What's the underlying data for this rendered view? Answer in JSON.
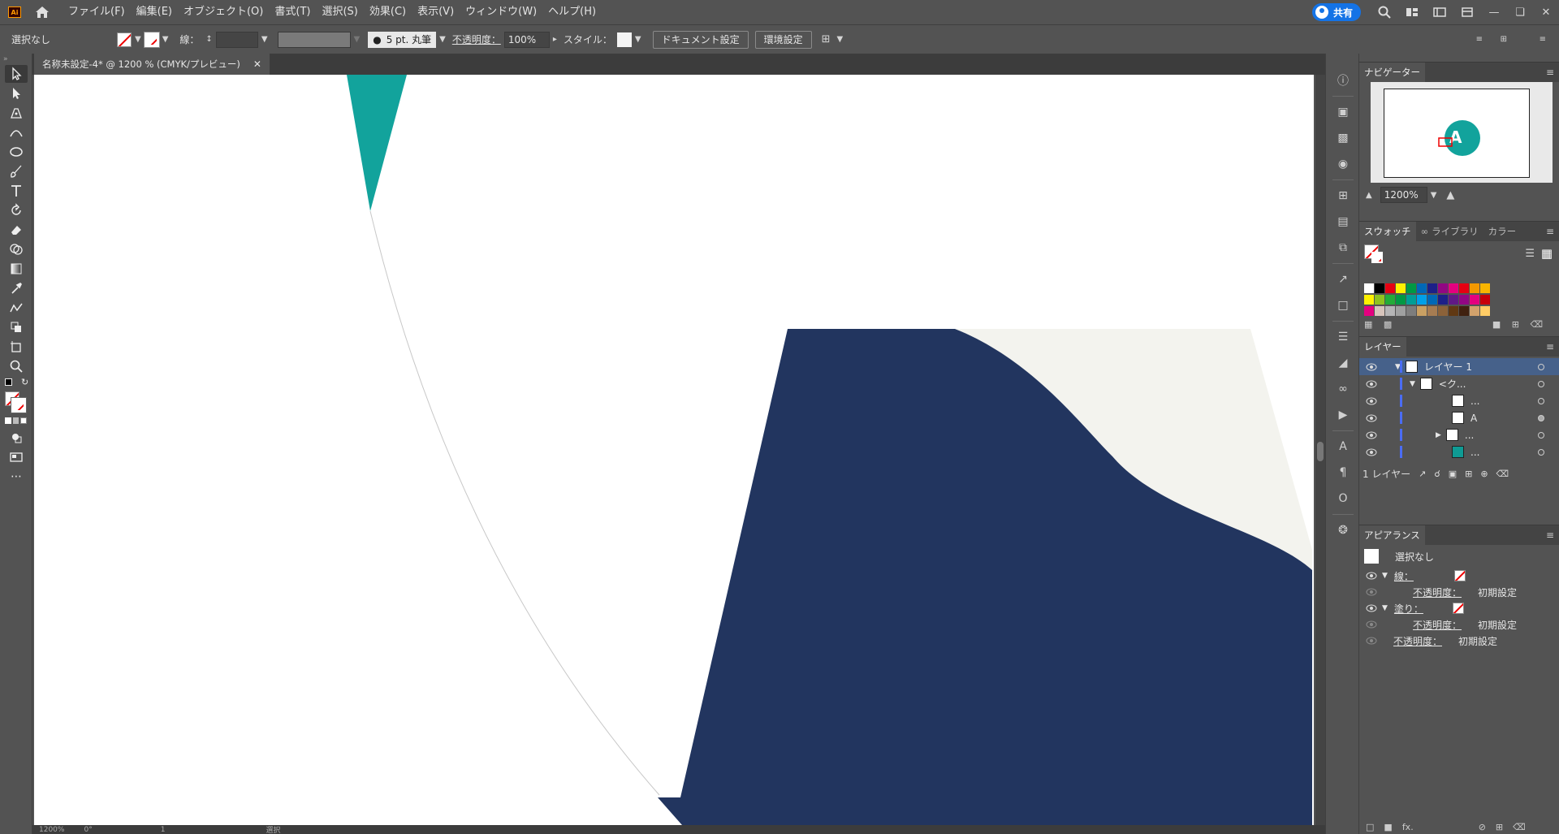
{
  "app": {
    "logo_text": "Ai"
  },
  "menu": [
    "ファイル(F)",
    "編集(E)",
    "オブジェクト(O)",
    "書式(T)",
    "選択(S)",
    "効果(C)",
    "表示(V)",
    "ウィンドウ(W)",
    "ヘルプ(H)"
  ],
  "topright": {
    "share_label": "共有"
  },
  "control": {
    "selection": "選択なし",
    "stroke_label": "線：",
    "brush": "5 pt. 丸筆",
    "opacity_label": "不透明度：",
    "opacity_value": "100%",
    "style_label": "スタイル：",
    "doc_setup": "ドキュメント設定",
    "prefs": "環境設定"
  },
  "document": {
    "tab_title": "名称未設定-4* @ 1200 % (CMYK/プレビュー)"
  },
  "statusbar": {
    "zoom": "1200%",
    "angle": "0°",
    "artboard": "1",
    "tool": "選択"
  },
  "navigator": {
    "tab": "ナビゲーター",
    "zoom": "1200%"
  },
  "swatches": {
    "tabs": [
      "スウォッチ",
      "ライブラリ",
      "カラー"
    ],
    "row1": [
      "#ffffff",
      "#000000",
      "#e60012",
      "#fff100",
      "#009944",
      "#0068b7",
      "#1d2088",
      "#920783",
      "#e4007f",
      "#e60012",
      "#f39800",
      "#f8b500"
    ],
    "row2": [
      "#fff100",
      "#8fc31f",
      "#22ac38",
      "#009944",
      "#009e96",
      "#00a0e9",
      "#0068b7",
      "#1d2088",
      "#601986",
      "#920783",
      "#e4007f",
      "#c7000b"
    ],
    "row3": [
      "#e4007f",
      "#d7c4bb",
      "#b5b5b6",
      "#9fa0a0",
      "#7d7d7d",
      "#c9a063",
      "#a67c52",
      "#8c6239",
      "#603813",
      "#40210f",
      "#d2a26c",
      "#ffcc66"
    ]
  },
  "layers": {
    "tab": "レイヤー",
    "rows": [
      {
        "label": "レイヤー 1",
        "thumb": "#ffffff"
      },
      {
        "label": "<ク...",
        "thumb": "#ffffff"
      },
      {
        "label": "...",
        "thumb": "#ffffff"
      },
      {
        "label": "A",
        "thumb": "#ffffff"
      },
      {
        "label": "...",
        "thumb": "#ffffff"
      },
      {
        "label": "...",
        "thumb": "#0f9b94"
      }
    ],
    "footer": "1 レイヤー"
  },
  "appearance": {
    "tab": "アピアランス",
    "title": "選択なし",
    "stroke": "線：",
    "fill": "塗り：",
    "opacity_label": "不透明度：",
    "opacity_value": "初期設定"
  },
  "colors": {
    "teal": "#12a39c",
    "navy": "#22355f",
    "cream": "#f3f3ee",
    "accent": "#1473e6"
  }
}
